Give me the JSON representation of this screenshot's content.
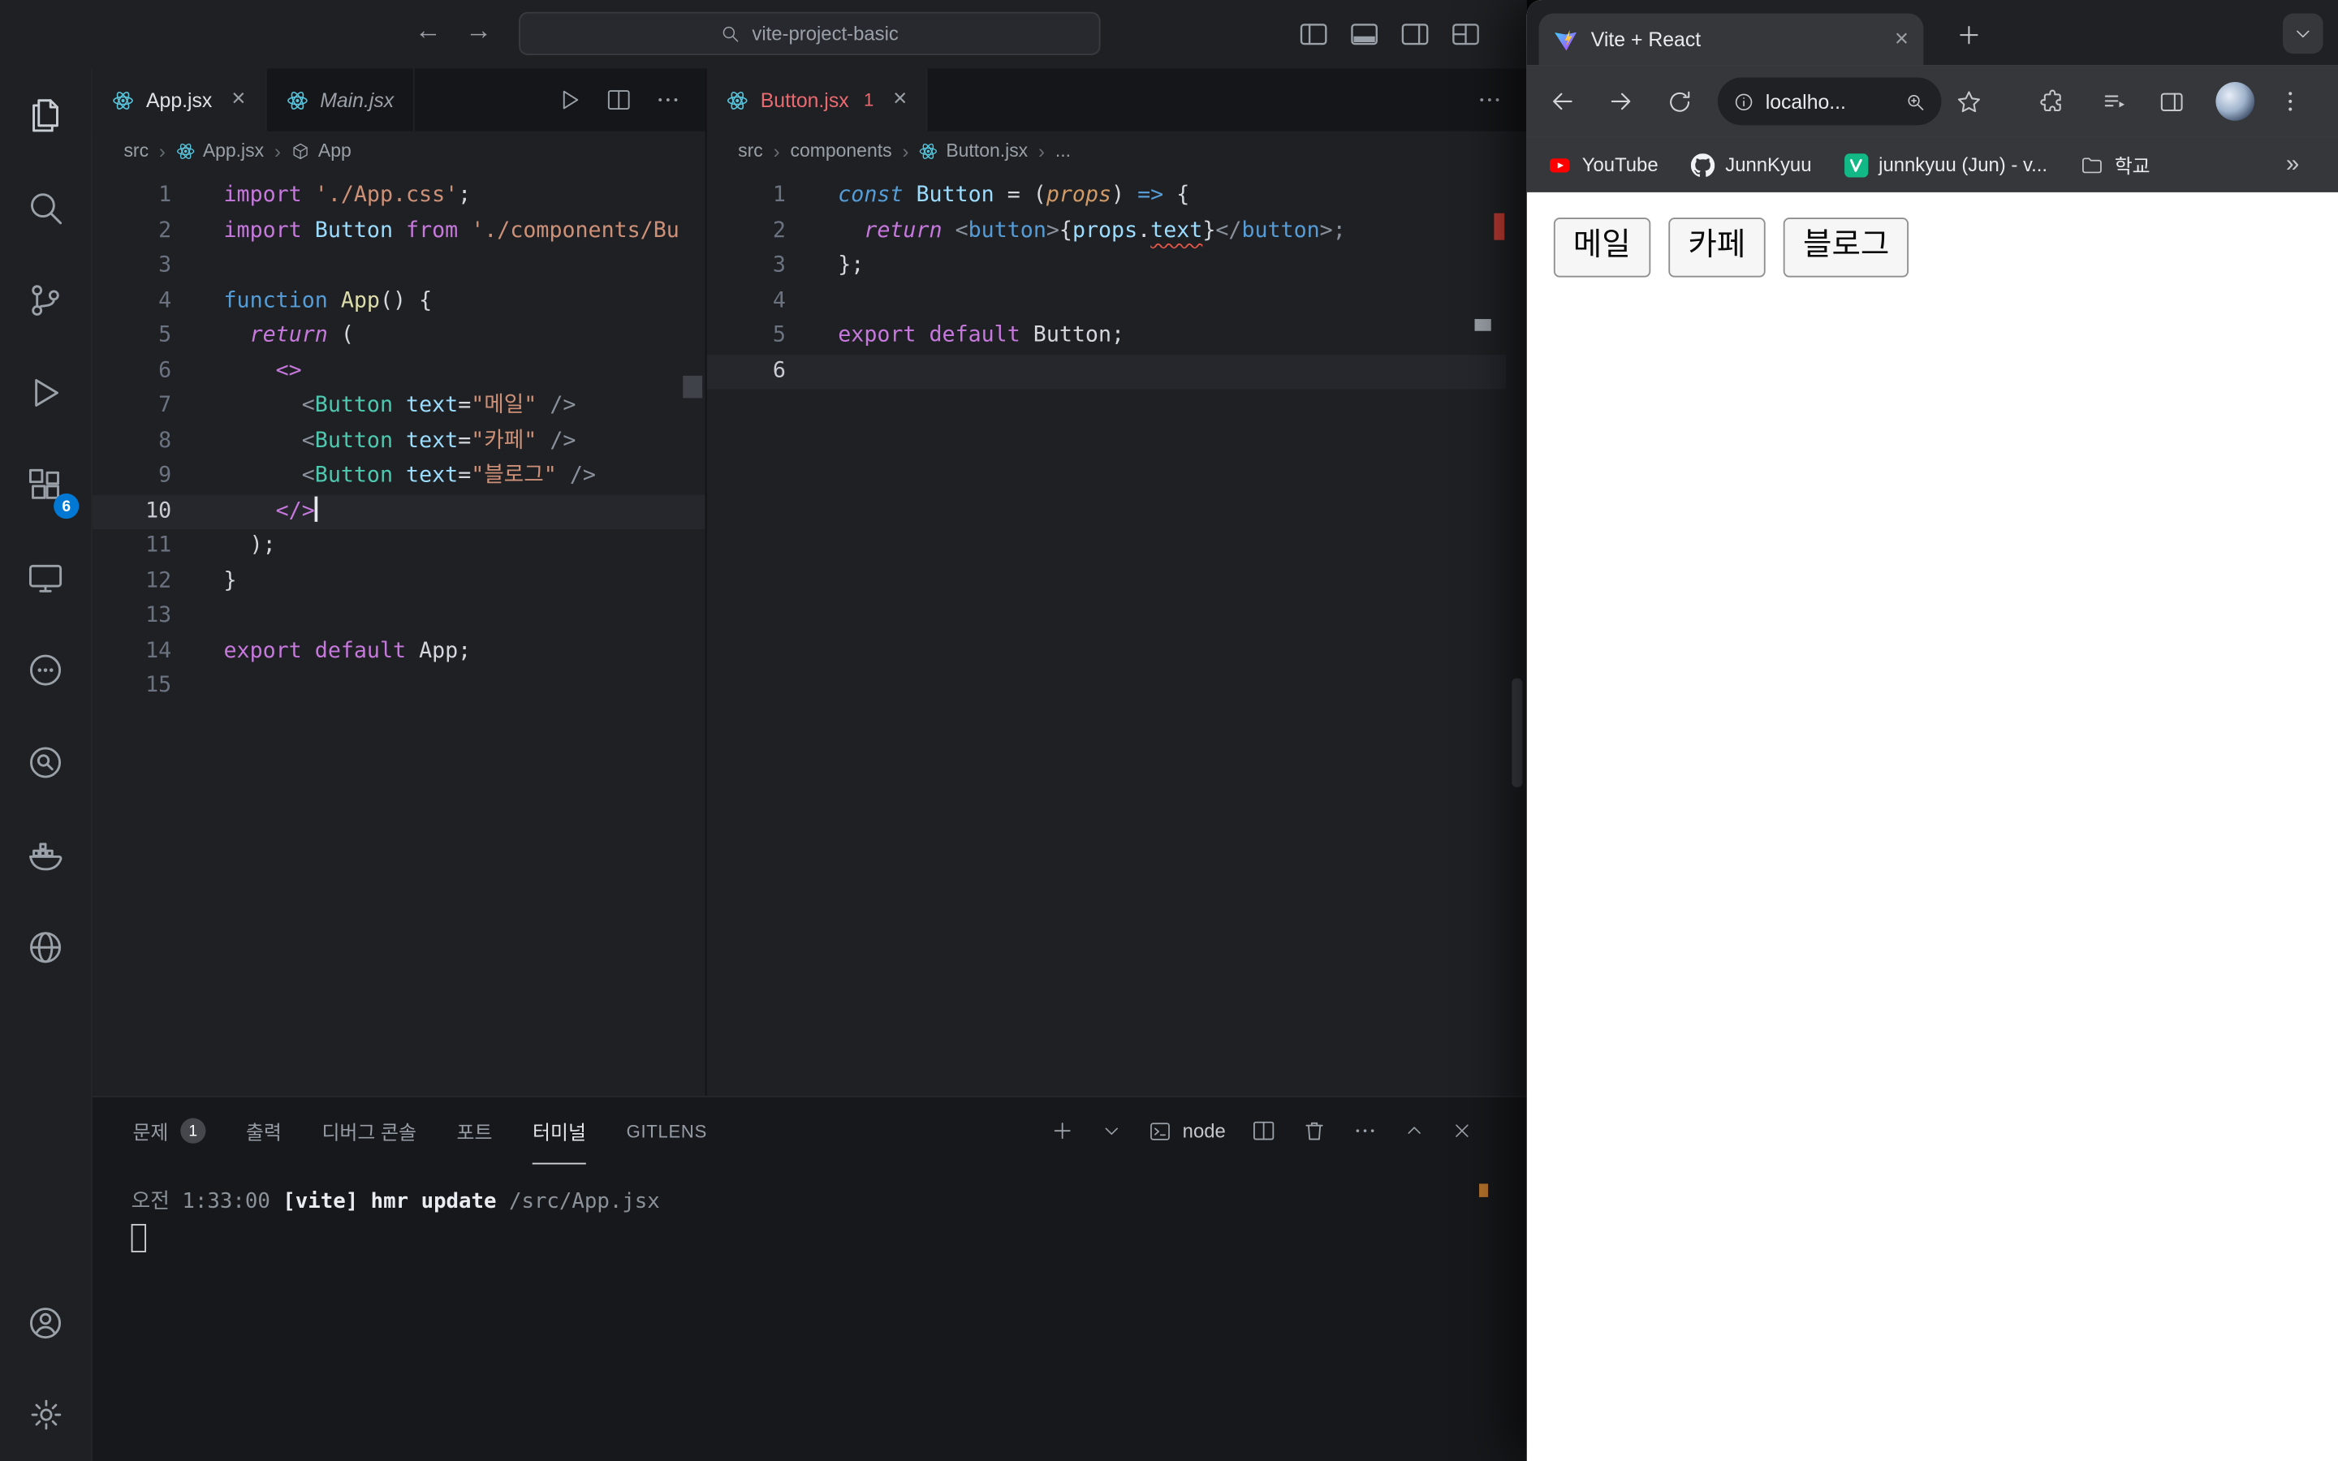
{
  "colors": {
    "activity_badge": "#0078d4",
    "error": "#e45649",
    "youtube_red": "#ff0000",
    "velog_green": "#12b886",
    "react_blue": "#58c4dc"
  },
  "vscode": {
    "titlebar": {
      "search": "vite-project-basic"
    },
    "activity": {
      "extensions_badge": "6"
    },
    "left_editor": {
      "tabs": [
        {
          "label": "App.jsx"
        },
        {
          "label": "Main.jsx"
        }
      ],
      "breadcrumb": [
        "src",
        "App.jsx",
        "App"
      ],
      "lines": [
        {
          "toks": [
            {
              "t": "import",
              "c": "kw"
            },
            {
              "t": " ",
              "c": "pun"
            },
            {
              "t": "'./App.css'",
              "c": "str"
            },
            {
              "t": ";",
              "c": "pun"
            }
          ]
        },
        {
          "toks": [
            {
              "t": "import",
              "c": "kw"
            },
            {
              "t": " ",
              "c": "pun"
            },
            {
              "t": "Button",
              "c": "var"
            },
            {
              "t": " ",
              "c": "pun"
            },
            {
              "t": "from",
              "c": "kw"
            },
            {
              "t": " ",
              "c": "pun"
            },
            {
              "t": "'./components/Bu",
              "c": "str"
            }
          ]
        },
        {
          "toks": []
        },
        {
          "toks": [
            {
              "t": "function",
              "c": "kwb"
            },
            {
              "t": " ",
              "c": "pun"
            },
            {
              "t": "App",
              "c": "fn"
            },
            {
              "t": "() {",
              "c": "pun"
            }
          ]
        },
        {
          "toks": [
            {
              "t": "  ",
              "c": "pun"
            },
            {
              "t": "return",
              "c": "kwi"
            },
            {
              "t": " (",
              "c": "pun"
            }
          ]
        },
        {
          "toks": [
            {
              "t": "    ",
              "c": "pun"
            },
            {
              "t": "<>",
              "c": "frag"
            }
          ]
        },
        {
          "toks": [
            {
              "t": "      ",
              "c": "pun"
            },
            {
              "t": "<",
              "c": "br"
            },
            {
              "t": "Button",
              "c": "comp"
            },
            {
              "t": " ",
              "c": "pun"
            },
            {
              "t": "text",
              "c": "attr"
            },
            {
              "t": "=",
              "c": "pun"
            },
            {
              "t": "\"메일\"",
              "c": "str"
            },
            {
              "t": " ",
              "c": "pun"
            },
            {
              "t": "/>",
              "c": "br"
            }
          ]
        },
        {
          "toks": [
            {
              "t": "      ",
              "c": "pun"
            },
            {
              "t": "<",
              "c": "br"
            },
            {
              "t": "Button",
              "c": "comp"
            },
            {
              "t": " ",
              "c": "pun"
            },
            {
              "t": "text",
              "c": "attr"
            },
            {
              "t": "=",
              "c": "pun"
            },
            {
              "t": "\"카페\"",
              "c": "str"
            },
            {
              "t": " ",
              "c": "pun"
            },
            {
              "t": "/>",
              "c": "br"
            }
          ]
        },
        {
          "toks": [
            {
              "t": "      ",
              "c": "pun"
            },
            {
              "t": "<",
              "c": "br"
            },
            {
              "t": "Button",
              "c": "comp"
            },
            {
              "t": " ",
              "c": "pun"
            },
            {
              "t": "text",
              "c": "attr"
            },
            {
              "t": "=",
              "c": "pun"
            },
            {
              "t": "\"블로그\"",
              "c": "str"
            },
            {
              "t": " ",
              "c": "pun"
            },
            {
              "t": "/>",
              "c": "br"
            }
          ]
        },
        {
          "cur": true,
          "caret": true,
          "toks": [
            {
              "t": "    ",
              "c": "pun"
            },
            {
              "t": "</>",
              "c": "frag"
            }
          ]
        },
        {
          "toks": [
            {
              "t": "  );",
              "c": "pun"
            }
          ]
        },
        {
          "toks": [
            {
              "t": "}",
              "c": "pun"
            }
          ]
        },
        {
          "toks": []
        },
        {
          "toks": [
            {
              "t": "export",
              "c": "kw"
            },
            {
              "t": " ",
              "c": "pun"
            },
            {
              "t": "default",
              "c": "kw"
            },
            {
              "t": " ",
              "c": "pun"
            },
            {
              "t": "App;",
              "c": "pun"
            }
          ]
        },
        {
          "toks": []
        }
      ]
    },
    "right_editor": {
      "tab": {
        "label": "Button.jsx",
        "badge": "1"
      },
      "breadcrumb": [
        "src",
        "components",
        "Button.jsx",
        "..."
      ],
      "lines": [
        {
          "toks": [
            {
              "t": "const",
              "c": "kwi2"
            },
            {
              "t": " ",
              "c": "pun"
            },
            {
              "t": "Button",
              "c": "var"
            },
            {
              "t": " = (",
              "c": "pun"
            },
            {
              "t": "props",
              "c": "param"
            },
            {
              "t": ") ",
              "c": "pun"
            },
            {
              "t": "=>",
              "c": "kwb"
            },
            {
              "t": " {",
              "c": "pun"
            }
          ]
        },
        {
          "toks": [
            {
              "t": "  ",
              "c": "pun"
            },
            {
              "t": "return",
              "c": "kwi"
            },
            {
              "t": " ",
              "c": "pun"
            },
            {
              "t": "<",
              "c": "br"
            },
            {
              "t": "button",
              "c": "tag"
            },
            {
              "t": ">",
              "c": "br"
            },
            {
              "t": "{",
              "c": "pun"
            },
            {
              "t": "props",
              "c": "var"
            },
            {
              "t": ".",
              "c": "pun"
            },
            {
              "t": "text",
              "c": "err"
            },
            {
              "t": "}",
              "c": "pun"
            },
            {
              "t": "</",
              "c": "br"
            },
            {
              "t": "button",
              "c": "tag"
            },
            {
              "t": ">;",
              "c": "br"
            }
          ]
        },
        {
          "toks": [
            {
              "t": "};",
              "c": "pun"
            }
          ]
        },
        {
          "toks": []
        },
        {
          "toks": [
            {
              "t": "export",
              "c": "kw"
            },
            {
              "t": " ",
              "c": "pun"
            },
            {
              "t": "default",
              "c": "kw"
            },
            {
              "t": " ",
              "c": "pun"
            },
            {
              "t": "Button;",
              "c": "pun"
            }
          ]
        },
        {
          "cur": true,
          "toks": []
        }
      ]
    },
    "panel": {
      "tabs": [
        {
          "label": "문제",
          "badge": "1"
        },
        {
          "label": "출력"
        },
        {
          "label": "디버그 콘솔"
        },
        {
          "label": "포트"
        },
        {
          "label": "터미널",
          "active": true
        },
        {
          "label": "GITLENS"
        }
      ],
      "terminal_instance": "node",
      "output": [
        {
          "t": "오전 1:33:00 ",
          "c": "dim"
        },
        {
          "t": "[vite]",
          "c": "bright"
        },
        {
          "t": " hmr update ",
          "c": "bright"
        },
        {
          "t": "/src/App.jsx",
          "c": "dim"
        }
      ]
    }
  },
  "browser": {
    "tab": {
      "title": "Vite + React"
    },
    "address": "localho...",
    "bookmarks": [
      {
        "label": "YouTube",
        "icon": "youtube-icon"
      },
      {
        "label": "JunnKyuu",
        "icon": "github-icon"
      },
      {
        "label": "junnkyuu (Jun) - v...",
        "icon": "velog-icon"
      },
      {
        "label": "학교",
        "icon": "folder-icon"
      }
    ],
    "page": {
      "buttons": [
        "메일",
        "카페",
        "블로그"
      ]
    }
  }
}
